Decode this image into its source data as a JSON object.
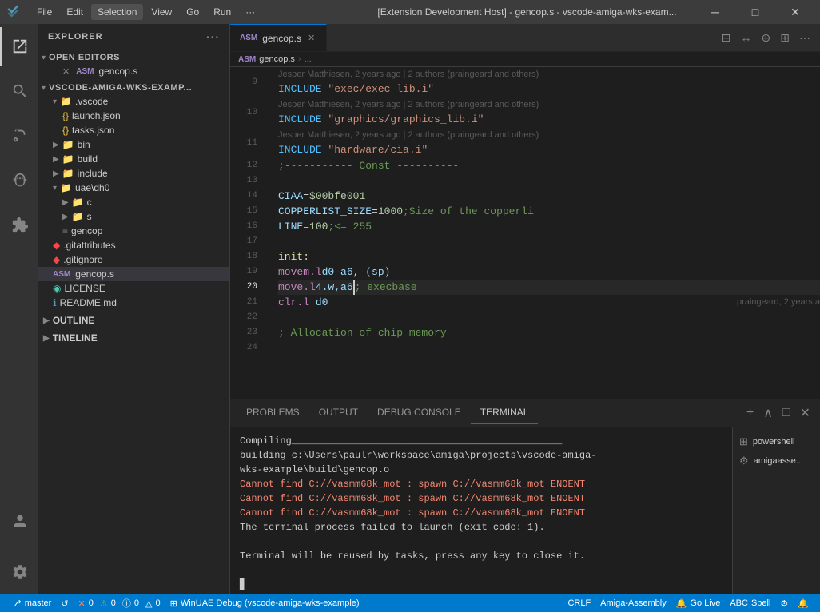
{
  "titleBar": {
    "logo": "⬡",
    "menuItems": [
      "File",
      "Edit",
      "Selection",
      "View",
      "Go",
      "Run",
      "···"
    ],
    "title": "[Extension Development Host] - gencop.s - vscode-amiga-wks-exam...",
    "minimize": "─",
    "maximize": "□",
    "close": "✕"
  },
  "activityBar": {
    "icons": [
      {
        "name": "explorer-icon",
        "symbol": "⎘",
        "active": true
      },
      {
        "name": "search-icon",
        "symbol": "🔍",
        "active": false
      },
      {
        "name": "source-control-icon",
        "symbol": "⎇",
        "active": false
      },
      {
        "name": "debug-icon",
        "symbol": "▷",
        "active": false
      },
      {
        "name": "extensions-icon",
        "symbol": "⊞",
        "active": false
      }
    ],
    "bottomIcons": [
      {
        "name": "account-icon",
        "symbol": "👤"
      },
      {
        "name": "settings-icon",
        "symbol": "⚙"
      }
    ]
  },
  "sidebar": {
    "title": "EXPLORER",
    "sections": {
      "openEditors": {
        "label": "OPEN EDITORS",
        "files": [
          {
            "name": "gencop.s",
            "icon": "ASM",
            "close": true
          }
        ]
      },
      "project": {
        "label": "VSCODE-AMIGA-WKS-EXAMP...",
        "items": [
          {
            "type": "folder",
            "name": ".vscode",
            "indent": 1,
            "open": true
          },
          {
            "type": "file",
            "name": "launch.json",
            "indent": 2,
            "icon": "json"
          },
          {
            "type": "file",
            "name": "tasks.json",
            "indent": 2,
            "icon": "json"
          },
          {
            "type": "folder",
            "name": "bin",
            "indent": 1,
            "open": false
          },
          {
            "type": "folder",
            "name": "build",
            "indent": 1,
            "open": false
          },
          {
            "type": "folder",
            "name": "include",
            "indent": 1,
            "open": false
          },
          {
            "type": "folder",
            "name": "uae\\dh0",
            "indent": 1,
            "open": true
          },
          {
            "type": "folder",
            "name": "c",
            "indent": 2,
            "open": false
          },
          {
            "type": "folder",
            "name": "s",
            "indent": 2,
            "open": false
          },
          {
            "type": "file",
            "name": "gencop",
            "indent": 2,
            "icon": "list"
          },
          {
            "type": "file",
            "name": ".gitattributes",
            "indent": 1,
            "icon": "git"
          },
          {
            "type": "file",
            "name": ".gitignore",
            "indent": 1,
            "icon": "git"
          },
          {
            "type": "file",
            "name": "gencop.s",
            "indent": 1,
            "icon": "asm",
            "active": true
          },
          {
            "type": "file",
            "name": "LICENSE",
            "indent": 1,
            "icon": "license"
          },
          {
            "type": "file",
            "name": "README.md",
            "indent": 1,
            "icon": "readme"
          }
        ]
      },
      "outline": {
        "label": "OUTLINE"
      },
      "timeline": {
        "label": "TIMELINE"
      }
    }
  },
  "editor": {
    "tab": {
      "label": "gencop.s",
      "icon": "ASM"
    },
    "breadcrumb": [
      "gencop.s",
      ">",
      "..."
    ],
    "lines": [
      {
        "num": "9",
        "blame": "Jesper Matthiesen, 2 years ago | 2 authors (praingeard and others)",
        "tokens": [
          {
            "text": "    INCLUDE",
            "cls": "kw-include"
          },
          {
            "text": "        ",
            "cls": ""
          },
          {
            "text": "\"exec/exec_lib.i\"",
            "cls": "kw-string"
          }
        ]
      },
      {
        "num": "10",
        "blame": "Jesper Matthiesen, 2 years ago | 2 authors (praingeard and others)",
        "tokens": [
          {
            "text": "    INCLUDE",
            "cls": "kw-include"
          },
          {
            "text": "        ",
            "cls": ""
          },
          {
            "text": "\"graphics/graphics_lib.i\"",
            "cls": "kw-string"
          }
        ]
      },
      {
        "num": "11",
        "blame": "Jesper Matthiesen, 2 years ago | 2 authors (praingeard and others)",
        "tokens": [
          {
            "text": "    INCLUDE",
            "cls": "kw-include"
          },
          {
            "text": "        ",
            "cls": ""
          },
          {
            "text": "\"hardware/cia.i\"",
            "cls": "kw-string"
          }
        ]
      },
      {
        "num": "12",
        "blame": "",
        "tokens": [
          {
            "text": ";----------- Const ----------",
            "cls": "kw-comment"
          }
        ]
      },
      {
        "num": "13",
        "blame": "",
        "tokens": []
      },
      {
        "num": "14",
        "blame": "",
        "tokens": [
          {
            "text": "CIAA",
            "cls": "kw-var"
          },
          {
            "text": "            = ",
            "cls": ""
          },
          {
            "text": "$00bfe001",
            "cls": "kw-number"
          }
        ]
      },
      {
        "num": "15",
        "blame": "",
        "tokens": [
          {
            "text": "COPPERLIST_SIZE",
            "cls": "kw-var"
          },
          {
            "text": " = ",
            "cls": ""
          },
          {
            "text": "1000",
            "cls": "kw-number"
          },
          {
            "text": "                                       ",
            "cls": ""
          },
          {
            "text": ";Size of the copperli",
            "cls": "kw-comment"
          }
        ]
      },
      {
        "num": "16",
        "blame": "",
        "tokens": [
          {
            "text": "LINE",
            "cls": "kw-var"
          },
          {
            "text": "            = ",
            "cls": ""
          },
          {
            "text": "100",
            "cls": "kw-number"
          },
          {
            "text": "                                          ",
            "cls": ""
          },
          {
            "text": ";<= 255",
            "cls": "kw-comment"
          }
        ]
      },
      {
        "num": "17",
        "blame": "",
        "tokens": []
      },
      {
        "num": "18",
        "blame": "",
        "tokens": [
          {
            "text": "init:",
            "cls": "kw-label"
          }
        ]
      },
      {
        "num": "19",
        "blame": "",
        "tokens": [
          {
            "text": "        movem.l",
            "cls": "kw-op"
          },
          {
            "text": "     d0-a6,-(sp)",
            "cls": "kw-register"
          }
        ]
      },
      {
        "num": "20",
        "blame": "",
        "tokens": [
          {
            "text": "        move.l",
            "cls": "kw-op"
          },
          {
            "text": "      4.w,a6",
            "cls": "kw-register"
          },
          {
            "text": "                                ",
            "cls": ""
          },
          {
            "text": "; execbase",
            "cls": "kw-comment"
          }
        ],
        "cursor": true
      },
      {
        "num": "21",
        "blame": "praingeard, 2 years a",
        "tokens": [
          {
            "text": "        clr.l",
            "cls": "kw-op"
          },
          {
            "text": "       d0",
            "cls": "kw-register"
          }
        ]
      },
      {
        "num": "22",
        "blame": "",
        "tokens": []
      },
      {
        "num": "23",
        "blame": "",
        "tokens": [
          {
            "text": "        ; Allocation of chip memory",
            "cls": "kw-comment"
          }
        ]
      },
      {
        "num": "24",
        "blame": "",
        "tokens": []
      }
    ]
  },
  "terminal": {
    "tabs": [
      "PROBLEMS",
      "OUTPUT",
      "DEBUG CONSOLE",
      "TERMINAL"
    ],
    "activeTab": "TERMINAL",
    "lines": [
      {
        "text": "Compiling_______________________________________________",
        "cls": ""
      },
      {
        "text": "building c:\\Users\\paulr\\workspace\\amiga\\projects\\vscode-amiga-",
        "cls": ""
      },
      {
        "text": "wks-example\\build\\gencop.o",
        "cls": ""
      },
      {
        "text": "Cannot find C://vasmm68k_mot : spawn C://vasmm68k_mot ENOENT",
        "cls": "term-error"
      },
      {
        "text": "Cannot find C://vasmm68k_mot : spawn C://vasmm68k_mot ENOENT",
        "cls": "term-error"
      },
      {
        "text": "Cannot find C://vasmm68k_mot : spawn C://vasmm68k_mot ENOENT",
        "cls": "term-error"
      },
      {
        "text": "The terminal process failed to launch (exit code: 1).",
        "cls": ""
      },
      {
        "text": "",
        "cls": ""
      },
      {
        "text": "Terminal will be reused by tasks, press any key to close it.",
        "cls": ""
      },
      {
        "text": "",
        "cls": ""
      },
      {
        "text": "▊",
        "cls": ""
      }
    ],
    "sideItems": [
      {
        "icon": "⊞",
        "label": "powershell"
      },
      {
        "icon": "⚙",
        "label": "amigaasse..."
      }
    ]
  },
  "statusBar": {
    "left": [
      {
        "text": " master",
        "icon": "⎇"
      },
      {
        "text": "↺"
      },
      {
        "text": "⚠ 0  ✕ 0  ⓘ 0  △ 0"
      },
      {
        "text": "⊞  WinUAE Debug (vscode-amiga-wks-example)"
      }
    ],
    "right": [
      {
        "text": "CRLF"
      },
      {
        "text": "Amiga-Assembly"
      },
      {
        "text": "🔔 Go Live"
      },
      {
        "text": "ABC Spell"
      },
      {
        "text": "⚙"
      },
      {
        "text": "🔔"
      }
    ]
  }
}
